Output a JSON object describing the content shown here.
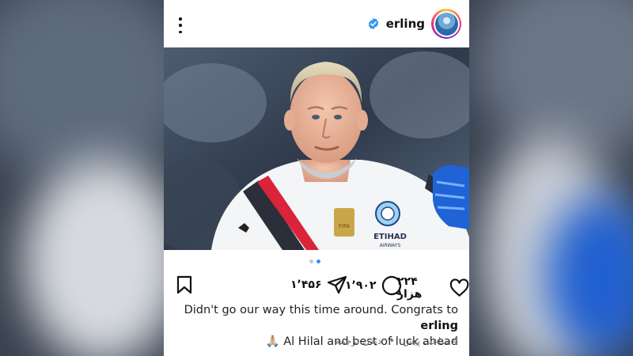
{
  "post": {
    "username": "erling",
    "avatar_icon": "profile-avatar-icon",
    "verified_icon": "verified-badge-icon",
    "more_icon": "more-vertical-icon",
    "media_icon": "player-photo",
    "carousel": {
      "total": 2,
      "active": 2
    },
    "likes": {
      "icon": "heart-icon",
      "count": "۲۲۴ هزار"
    },
    "comments": {
      "icon": "comment-icon",
      "count": "۱٬۹۰۲"
    },
    "shares": {
      "icon": "share-icon",
      "count": "۱٬۴۵۶"
    },
    "save_icon": "bookmark-icon",
    "caption": {
      "text_before": "Didn't go our way this time around. Congrats to ",
      "mention": "erling",
      "line2_emoji": "🙏🏼",
      "line2_text": "Al Hilal and best of luck ahead"
    },
    "time_ago": "4 ساعت پیش",
    "separator": "•",
    "translate_link": "دیدن ترجمه"
  },
  "colors": {
    "verified": "#3897f0",
    "active_dot": "#3a8ef6",
    "meta": "#737373"
  }
}
